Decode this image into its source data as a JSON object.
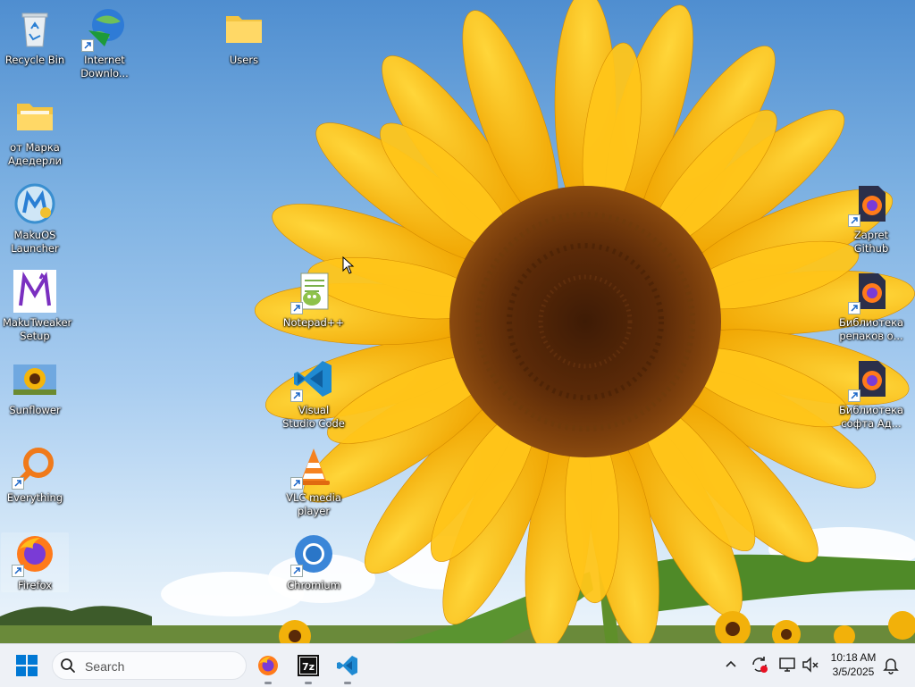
{
  "desktop": {
    "icons_left": [
      {
        "label": "Recycle Bin",
        "icon": "recycle-bin-icon"
      },
      {
        "label": "Internet Downlo...",
        "icon": "internet-download-manager-icon"
      },
      {
        "label": "Users",
        "icon": "folder-icon"
      },
      {
        "label": "от Марка Адедерли",
        "icon": "folder-icon"
      },
      {
        "label": "MakuOS Launcher",
        "icon": "makuos-launcher-icon"
      },
      {
        "label": "MakuTweaker Setup",
        "icon": "makutweaker-icon"
      },
      {
        "label": "Sunflower",
        "icon": "image-icon"
      },
      {
        "label": "Everything",
        "icon": "everything-search-icon"
      },
      {
        "label": "Firefox",
        "icon": "firefox-icon"
      }
    ],
    "icons_middle": [
      {
        "label": "Notepad++",
        "icon": "notepad-plus-plus-icon"
      },
      {
        "label": "Visual Studio Code",
        "icon": "vscode-icon"
      },
      {
        "label": "VLC media player",
        "icon": "vlc-icon"
      },
      {
        "label": "Chromium",
        "icon": "chromium-icon"
      }
    ],
    "icons_right": [
      {
        "label": "Zapret Github",
        "icon": "firefox-icon"
      },
      {
        "label": "Библиотека репаков о...",
        "icon": "firefox-icon"
      },
      {
        "label": "Библиотека софта Ад...",
        "icon": "firefox-icon"
      }
    ]
  },
  "taskbar": {
    "search_placeholder": "Search",
    "pinned_apps": [
      "firefox-icon",
      "7zip-icon",
      "vscode-icon"
    ],
    "tray_icons": [
      "chevron-up-icon",
      "update-sync-icon",
      "display-icon",
      "volume-muted-icon"
    ],
    "time": "10:18 AM",
    "date": "3/5/2025",
    "notification_icon": "bell-icon"
  },
  "colors": {
    "taskbar_bg": "#eef1f6",
    "windows_blue": "#0078d4",
    "sky_top": "#4f8ed0"
  }
}
